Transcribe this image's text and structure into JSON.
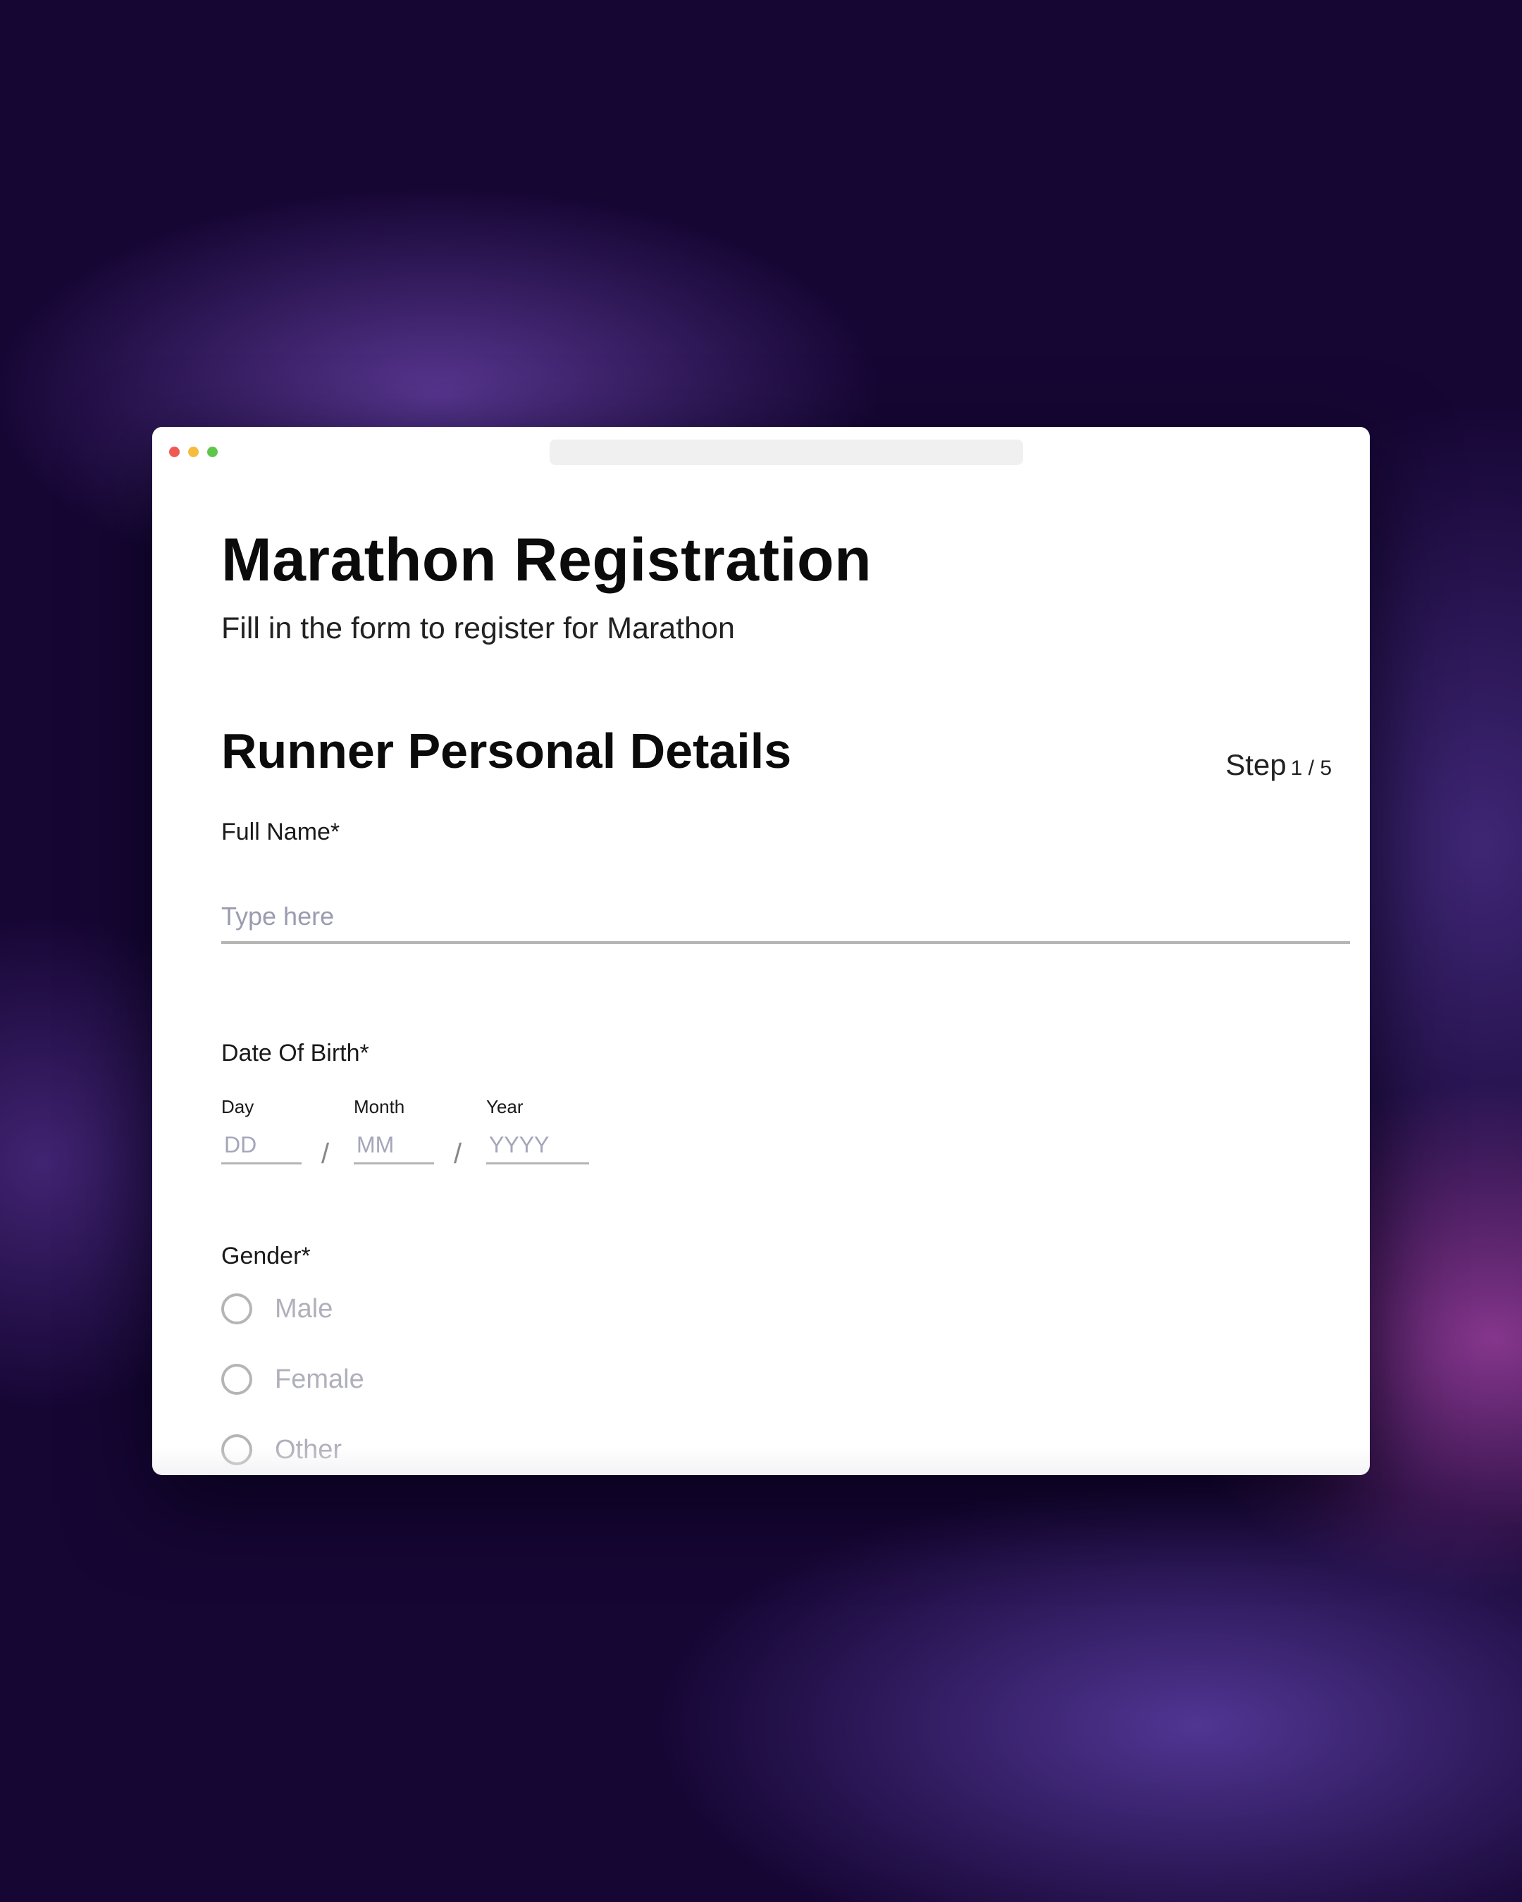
{
  "header": {
    "title": "Marathon Registration",
    "subtitle": "Fill in the form to register for Marathon"
  },
  "section": {
    "title": "Runner Personal Details",
    "step_word": "Step",
    "step_count": "1 / 5"
  },
  "full_name": {
    "label": "Full Name*",
    "placeholder": "Type here"
  },
  "dob": {
    "label": "Date Of Birth*",
    "day": {
      "label": "Day",
      "placeholder": "DD"
    },
    "month": {
      "label": "Month",
      "placeholder": "MM"
    },
    "year": {
      "label": "Year",
      "placeholder": "YYYY"
    },
    "separator": "/"
  },
  "gender": {
    "label": "Gender*",
    "options": [
      "Male",
      "Female",
      "Other"
    ]
  },
  "colors": {
    "background": "#160634",
    "window": "#ffffff",
    "placeholder": "#9b9bb0",
    "underline": "#b5b5b5",
    "traffic_red": "#ee5a52",
    "traffic_yellow": "#f4bd3f",
    "traffic_green": "#5fc64b"
  }
}
